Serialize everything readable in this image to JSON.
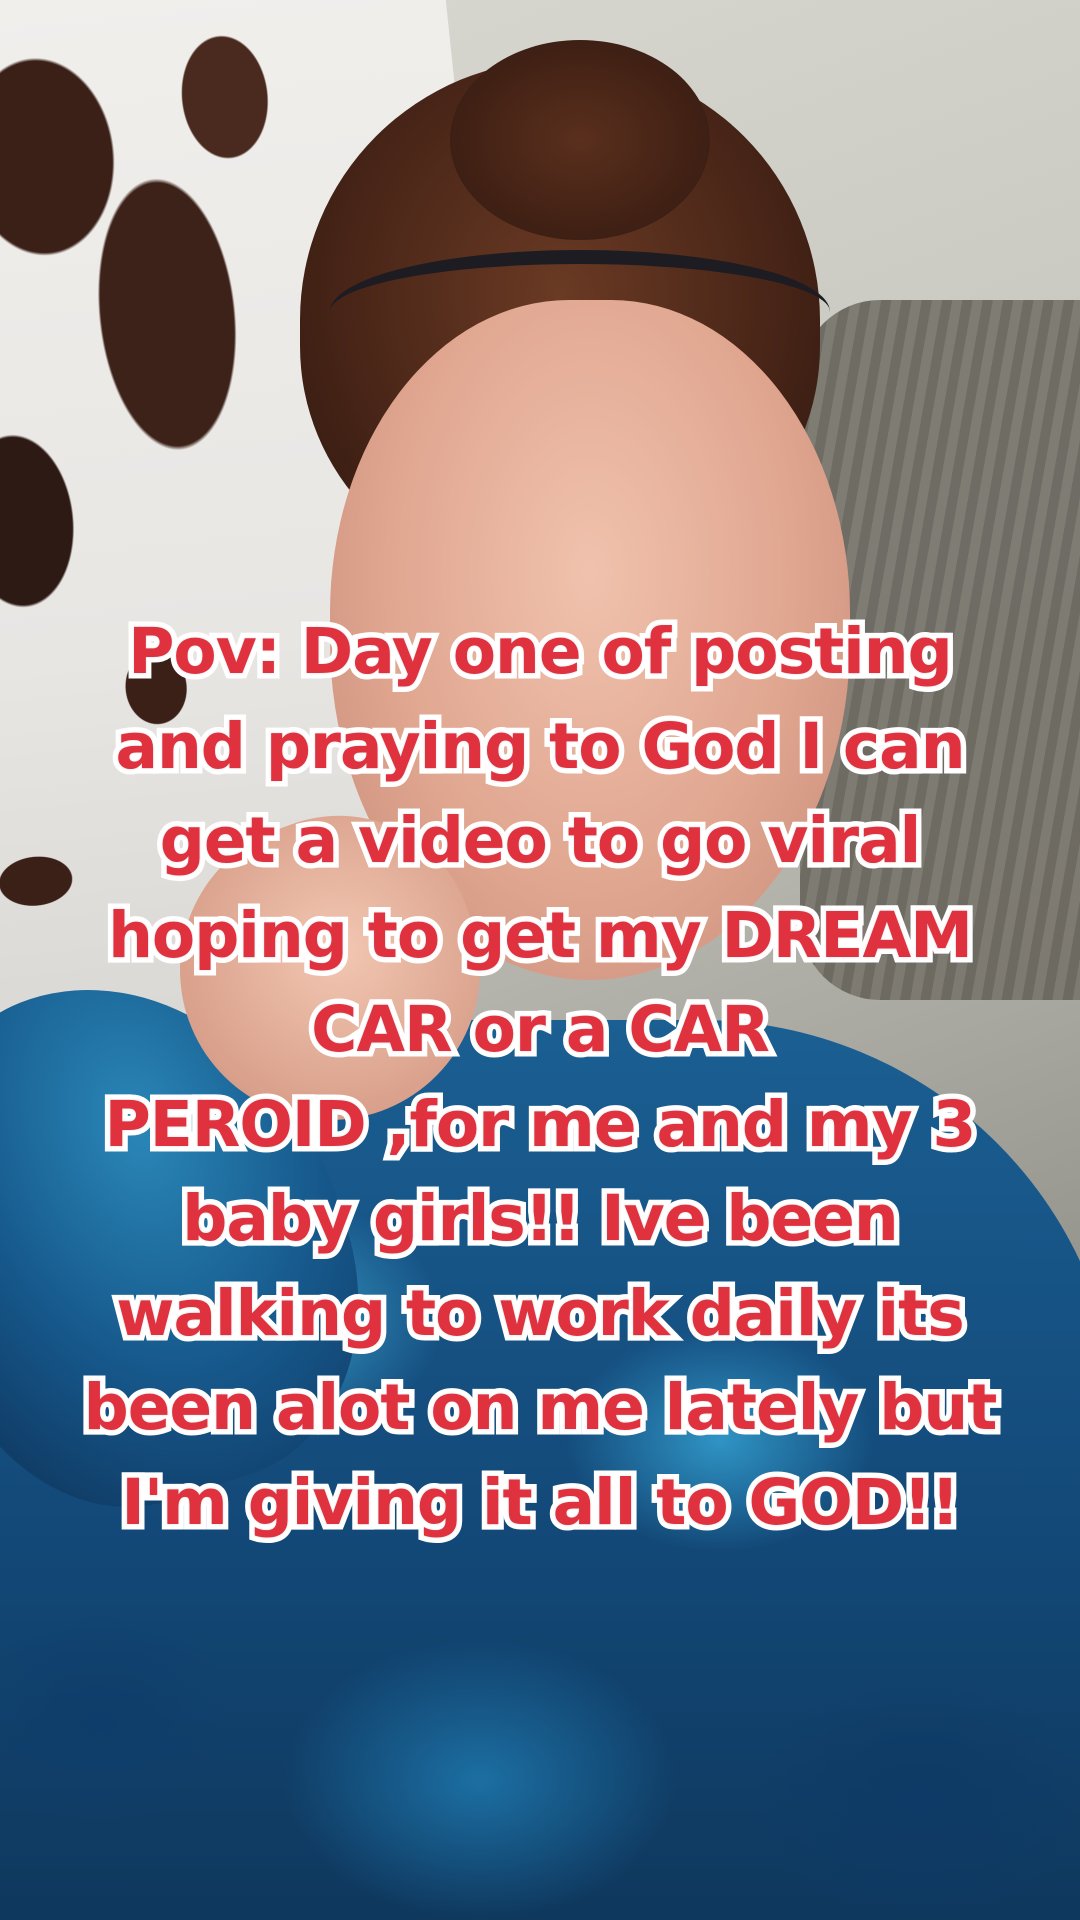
{
  "caption": {
    "lines": [
      "Pov: Day one of posting",
      "and praying to God I can",
      "get a video to go viral",
      "hoping to get my DREAM",
      "CAR or a CAR",
      "PEROID ,for me and my 3",
      "baby girls!! Ive been",
      "walking to work daily its",
      "been alot on me lately but",
      "I'm giving it all to GOD!!"
    ],
    "text_color": "#e0313f",
    "outline_color": "#ffffff"
  }
}
